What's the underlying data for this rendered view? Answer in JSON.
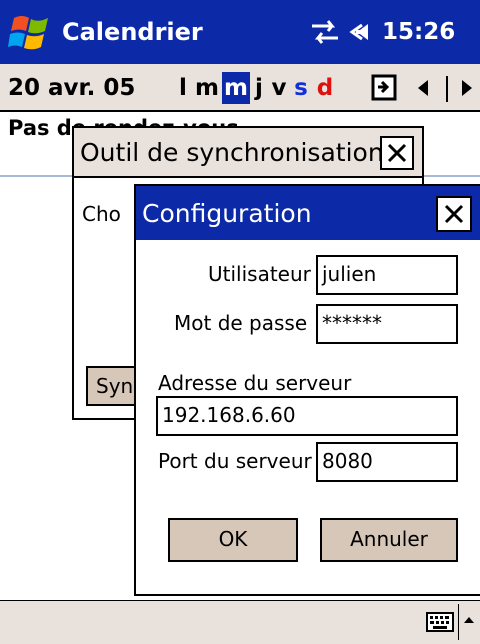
{
  "titlebar": {
    "app_title": "Calendrier",
    "clock": "15:26"
  },
  "navbar": {
    "date": "20 avr. 05",
    "days": [
      "l",
      "m",
      "m",
      "j",
      "v",
      "s",
      "d"
    ],
    "selected_day_index": 2
  },
  "agenda": {
    "empty_text": "Pas de rendez-vous"
  },
  "sync_dialog": {
    "title": "Outil de synchronisation",
    "choose_text": "Cho",
    "sync_button_label": "Syn"
  },
  "config_dialog": {
    "title": "Configuration",
    "user_label": "Utilisateur",
    "user_value": "julien",
    "password_label": "Mot de passe",
    "password_value": "******",
    "server_label": "Adresse du serveur",
    "server_value": "192.168.6.60",
    "port_label": "Port du serveur",
    "port_value": "8080",
    "ok_label": "OK",
    "cancel_label": "Annuler"
  },
  "colors": {
    "accent": "#0c2aa8",
    "chrome": "#e9e2dc",
    "button": "#d6c7b8",
    "saturday": "#1030d8",
    "sunday": "#e01010"
  },
  "icons": [
    "windows-start-icon",
    "sync-icon",
    "volume-icon",
    "goto-today-icon",
    "chevron-left-icon",
    "chevron-right-icon",
    "close-icon",
    "keyboard-icon",
    "chevron-up-icon"
  ]
}
